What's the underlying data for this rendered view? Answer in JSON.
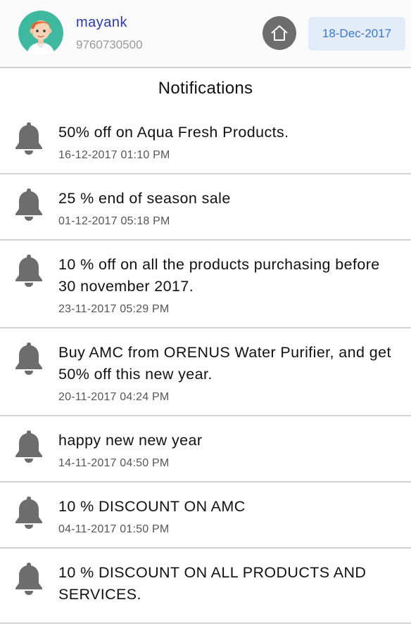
{
  "header": {
    "user_name": "mayank",
    "user_phone": "9760730500",
    "date": "18-Dec-2017",
    "home_icon": "home-icon",
    "avatar_icon": "avatar-icon"
  },
  "page_title": "Notifications",
  "notifications": [
    {
      "message": "50% off on Aqua Fresh Products.",
      "time": "16-12-2017 01:10 PM",
      "icon": "bell-icon"
    },
    {
      "message": "25 % end of season sale",
      "time": "01-12-2017 05:18 PM",
      "icon": "bell-icon"
    },
    {
      "message": "10 % off on all the products purchasing before 30 november 2017.",
      "time": "23-11-2017 05:29 PM",
      "icon": "bell-icon"
    },
    {
      "message": "Buy AMC from ORENUS Water Purifier, and get 50% off this new year.",
      "time": "20-11-2017 04:24 PM",
      "icon": "bell-icon"
    },
    {
      "message": "happy new new year",
      "time": "14-11-2017 04:50 PM",
      "icon": "bell-icon"
    },
    {
      "message": "10 % DISCOUNT ON AMC",
      "time": "04-11-2017 01:50 PM",
      "icon": "bell-icon"
    },
    {
      "message": "10 % DISCOUNT ON ALL PRODUCTS AND SERVICES.",
      "time": "",
      "icon": "bell-icon"
    }
  ],
  "colors": {
    "username": "#2b3aa8",
    "date_text": "#3a78c9",
    "date_bg": "#e3ecf8",
    "icon_gray": "#6d6d6d",
    "divider": "#d4d4d4"
  }
}
